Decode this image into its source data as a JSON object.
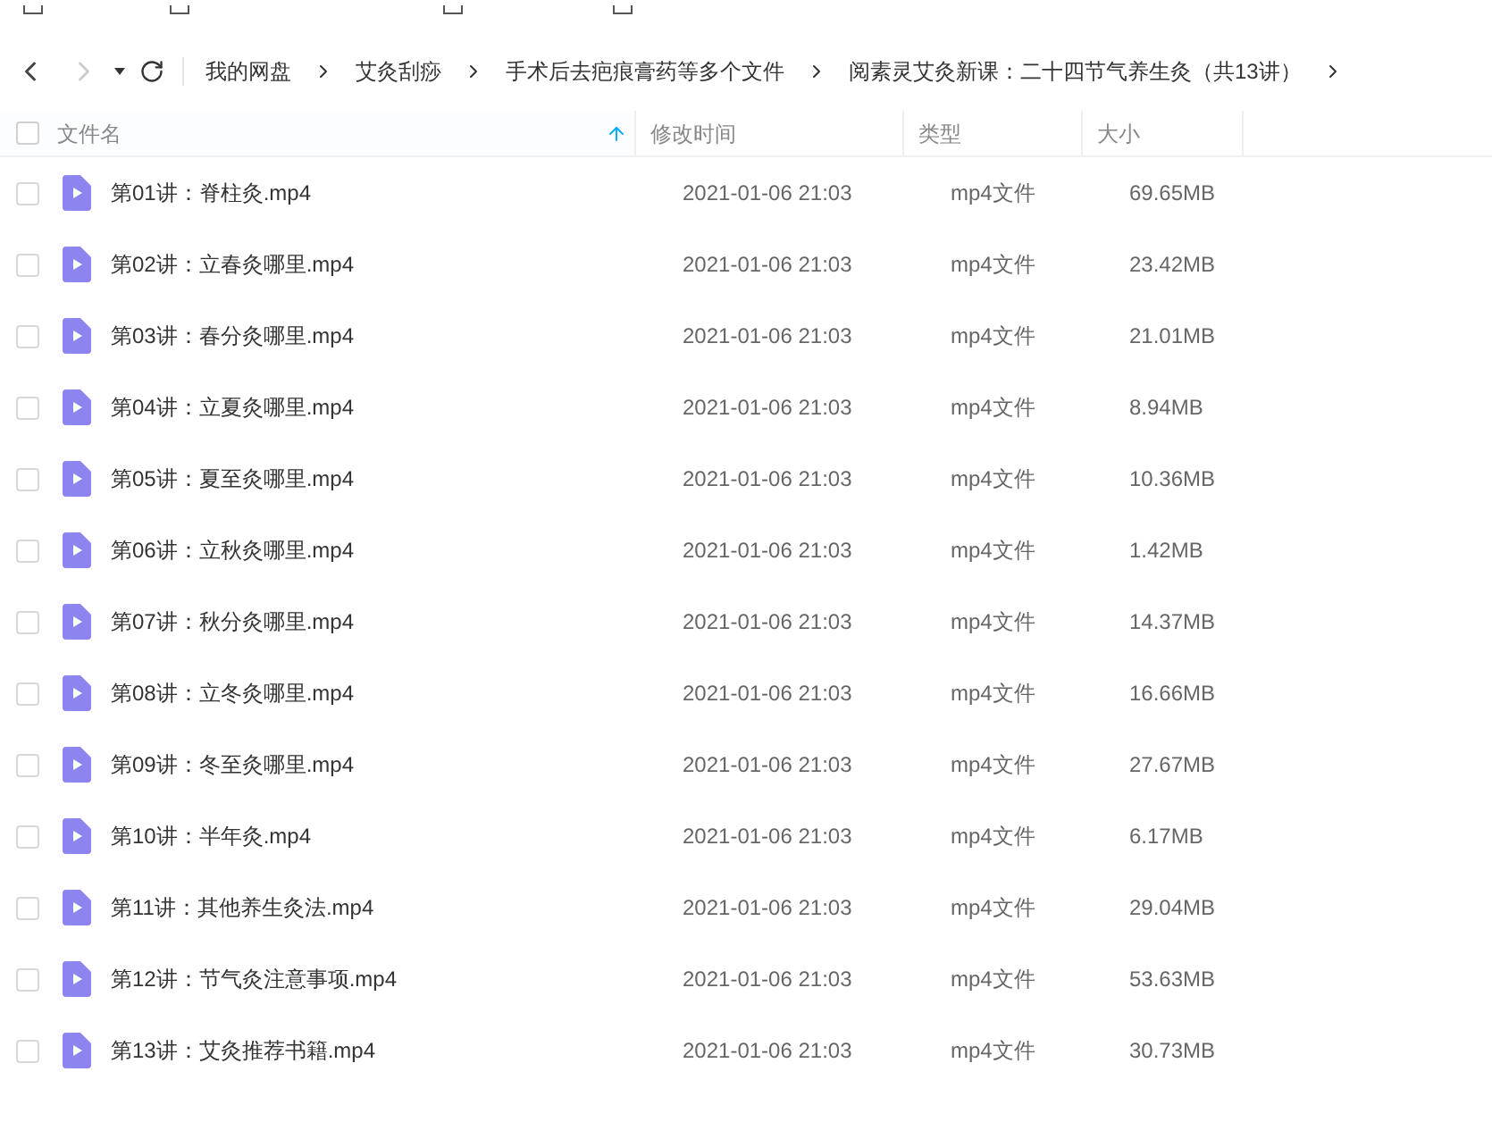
{
  "breadcrumb": [
    "我的网盘",
    "艾灸刮痧",
    "手术后去疤痕膏药等多个文件",
    "阅素灵艾灸新课：二十四节气养生灸（共13讲）"
  ],
  "table": {
    "select_all": {
      "checked": false
    },
    "columns": [
      {
        "label": "文件名",
        "sorted": true
      },
      {
        "label": "修改时间",
        "sorted": false
      },
      {
        "label": "类型",
        "sorted": false
      },
      {
        "label": "大小",
        "sorted": false
      }
    ],
    "rows": [
      {
        "name": "第01讲：脊柱灸.mp4",
        "modified": "2021-01-06 21:03",
        "type": "mp4文件",
        "size": "69.65MB",
        "checked": false
      },
      {
        "name": "第02讲：立春灸哪里.mp4",
        "modified": "2021-01-06 21:03",
        "type": "mp4文件",
        "size": "23.42MB",
        "checked": false
      },
      {
        "name": "第03讲：春分灸哪里.mp4",
        "modified": "2021-01-06 21:03",
        "type": "mp4文件",
        "size": "21.01MB",
        "checked": false
      },
      {
        "name": "第04讲：立夏灸哪里.mp4",
        "modified": "2021-01-06 21:03",
        "type": "mp4文件",
        "size": "8.94MB",
        "checked": false
      },
      {
        "name": "第05讲：夏至灸哪里.mp4",
        "modified": "2021-01-06 21:03",
        "type": "mp4文件",
        "size": "10.36MB",
        "checked": false
      },
      {
        "name": "第06讲：立秋灸哪里.mp4",
        "modified": "2021-01-06 21:03",
        "type": "mp4文件",
        "size": "1.42MB",
        "checked": false
      },
      {
        "name": "第07讲：秋分灸哪里.mp4",
        "modified": "2021-01-06 21:03",
        "type": "mp4文件",
        "size": "14.37MB",
        "checked": false
      },
      {
        "name": "第08讲：立冬灸哪里.mp4",
        "modified": "2021-01-06 21:03",
        "type": "mp4文件",
        "size": "16.66MB",
        "checked": false
      },
      {
        "name": "第09讲：冬至灸哪里.mp4",
        "modified": "2021-01-06 21:03",
        "type": "mp4文件",
        "size": "27.67MB",
        "checked": false
      },
      {
        "name": "第10讲：半年灸.mp4",
        "modified": "2021-01-06 21:03",
        "type": "mp4文件",
        "size": "6.17MB",
        "checked": false
      },
      {
        "name": "第11讲：其他养生灸法.mp4",
        "modified": "2021-01-06 21:03",
        "type": "mp4文件",
        "size": "29.04MB",
        "checked": false
      },
      {
        "name": "第12讲：节气灸注意事项.mp4",
        "modified": "2021-01-06 21:03",
        "type": "mp4文件",
        "size": "53.63MB",
        "checked": false
      },
      {
        "name": "第13讲：艾灸推荐书籍.mp4",
        "modified": "2021-01-06 21:03",
        "type": "mp4文件",
        "size": "30.73MB",
        "checked": false
      }
    ]
  }
}
